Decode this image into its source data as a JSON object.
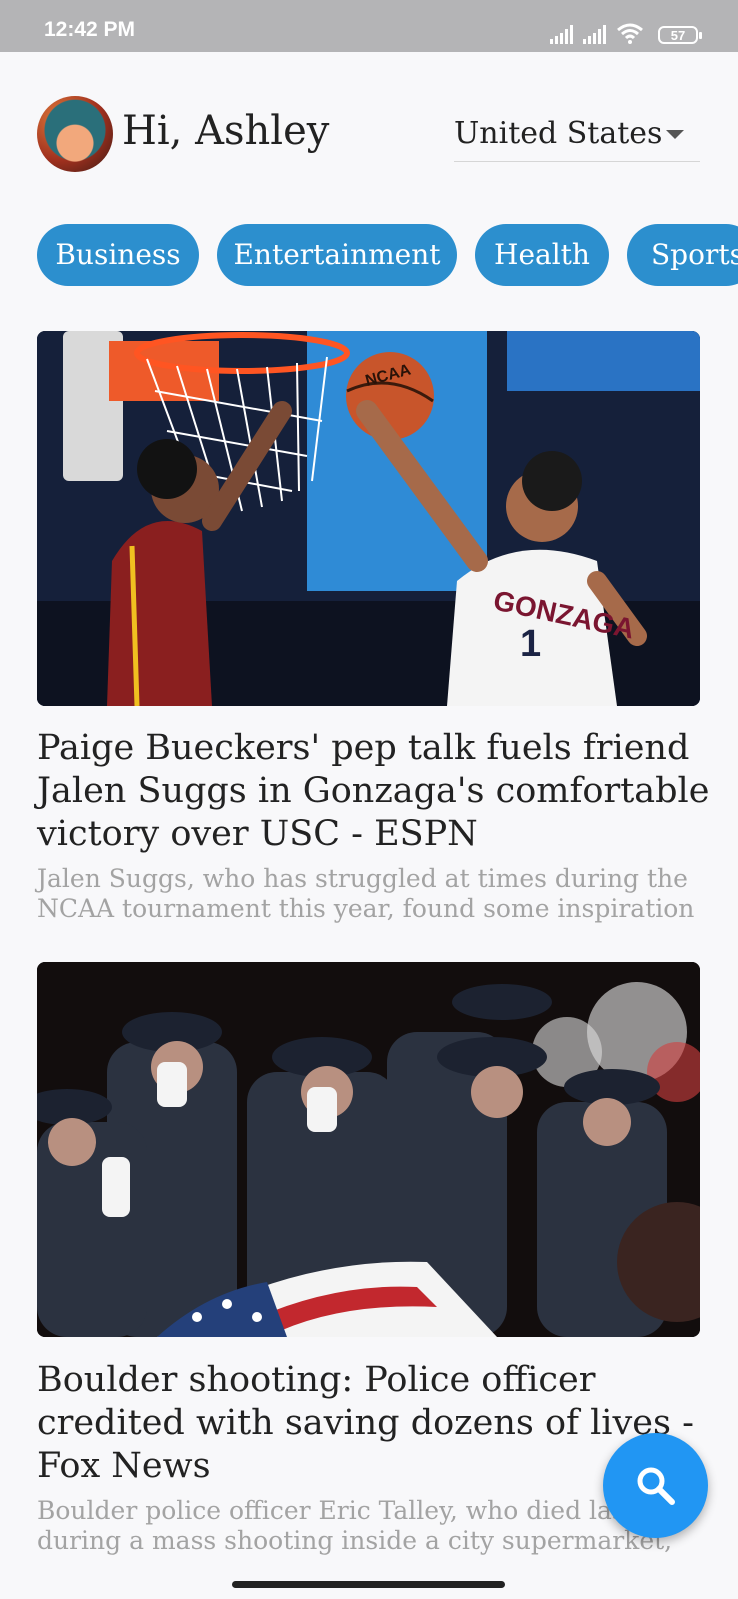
{
  "status_bar": {
    "time": "12:42 PM",
    "battery": "57"
  },
  "header": {
    "greeting": "Hi, Ashley",
    "country": "United States"
  },
  "categories": [
    "Business",
    "Entertainment",
    "Health",
    "Sports"
  ],
  "articles": [
    {
      "title": "Paige Bueckers' pep talk fuels friend Jalen Suggs in Gonzaga's comfortable victory over USC - ESPN",
      "description": "Jalen Suggs, who has struggled at times during the NCAA tournament this year, found some inspiration",
      "image_text": {
        "ball": "NCAA",
        "jersey": "GONZAGA",
        "number": "1"
      }
    },
    {
      "title": "Boulder shooting: Police officer credited with saving dozens of lives - Fox News",
      "description": "Boulder police officer Eric Talley, who died last during a mass shooting inside a city supermarket,"
    }
  ],
  "colors": {
    "accent": "#2c8fce",
    "fab": "#2196f3",
    "status_bar": "#b4b4b6"
  },
  "fab_icon": "search-icon"
}
